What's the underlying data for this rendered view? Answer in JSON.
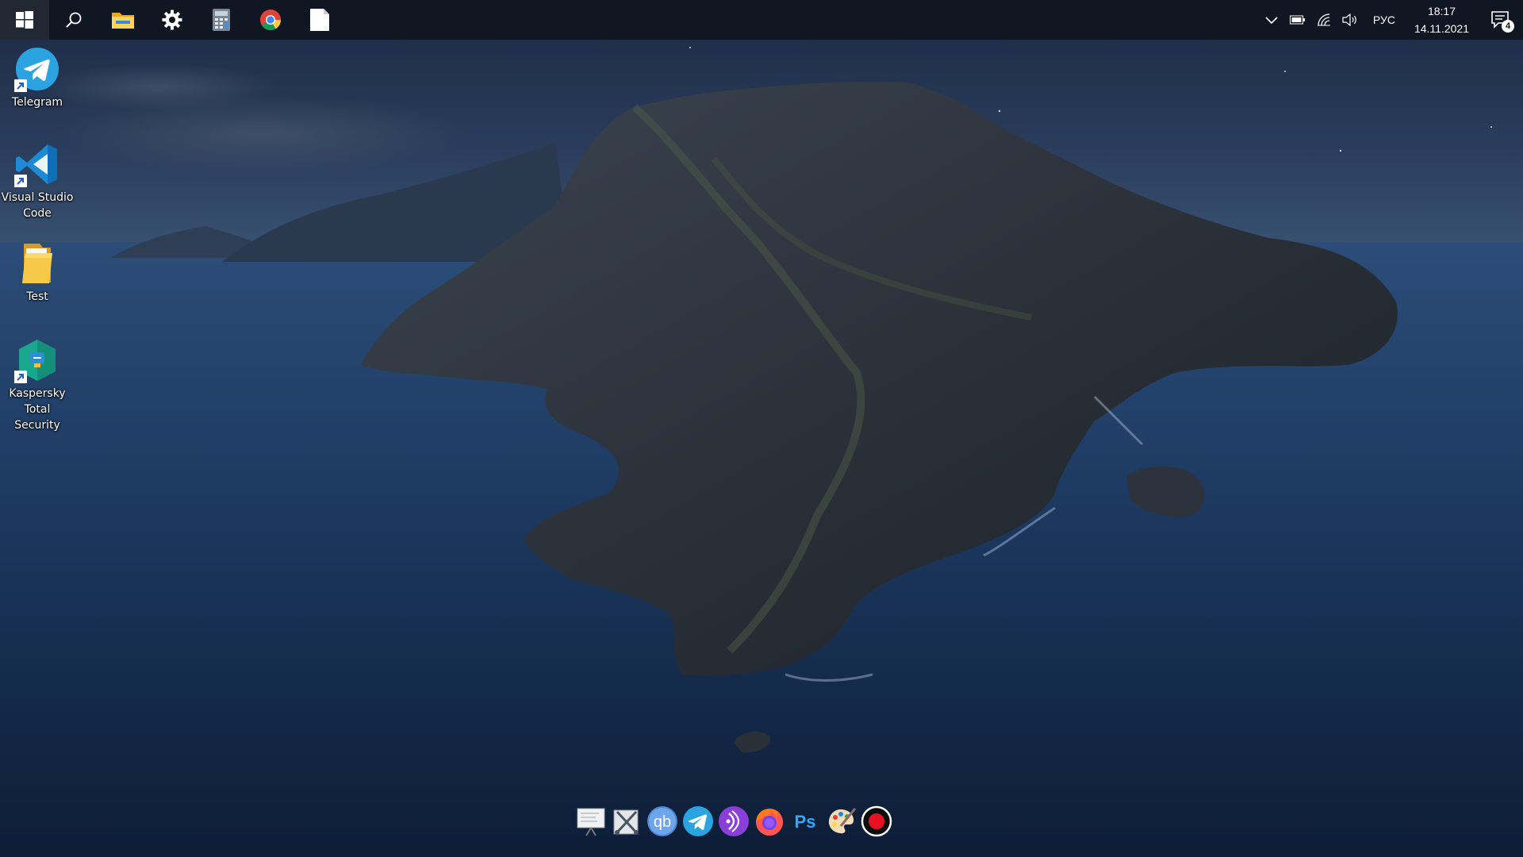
{
  "taskbar": {
    "pinned": [
      {
        "name": "Start",
        "icon": "windows-start-icon"
      },
      {
        "name": "Search",
        "icon": "search-icon"
      },
      {
        "name": "File Explorer",
        "icon": "folder-icon"
      },
      {
        "name": "Settings",
        "icon": "gear-icon"
      },
      {
        "name": "Calculator",
        "icon": "calculator-icon"
      },
      {
        "name": "Google Chrome",
        "icon": "chrome-icon"
      },
      {
        "name": "Document",
        "icon": "blank-document-icon"
      }
    ],
    "tray": {
      "language": "РУС",
      "time": "18:17",
      "date": "14.11.2021",
      "notification_count": "4"
    }
  },
  "desktop": {
    "icons": [
      {
        "label_lines": [
          "Telegram"
        ],
        "icon": "telegram-icon",
        "shortcut": true
      },
      {
        "label_lines": [
          "Visual Studio",
          "Code"
        ],
        "icon": "vscode-icon",
        "shortcut": true
      },
      {
        "label_lines": [
          "Test"
        ],
        "icon": "folder-icon",
        "shortcut": false
      },
      {
        "label_lines": [
          "Kaspersky",
          "Total Security"
        ],
        "icon": "kaspersky-icon",
        "shortcut": true
      }
    ]
  },
  "dock": {
    "items": [
      {
        "icon": "presentation-board-icon"
      },
      {
        "icon": "scissors-tool-icon"
      },
      {
        "icon": "qbittorrent-icon",
        "text": "qb"
      },
      {
        "icon": "telegram-icon"
      },
      {
        "icon": "podcast-icon"
      },
      {
        "icon": "firefox-icon"
      },
      {
        "icon": "photoshop-icon",
        "text": "Ps"
      },
      {
        "icon": "paint-palette-icon"
      },
      {
        "icon": "record-icon"
      }
    ]
  },
  "colors": {
    "taskbar_bg": "#10161f",
    "sky_top": "#1a2842",
    "sea": "#1b3357",
    "telegram": "#2aa3e0",
    "vscode": "#1e8ad6",
    "kaspersky": "#19a88e",
    "record": "#e81123"
  }
}
